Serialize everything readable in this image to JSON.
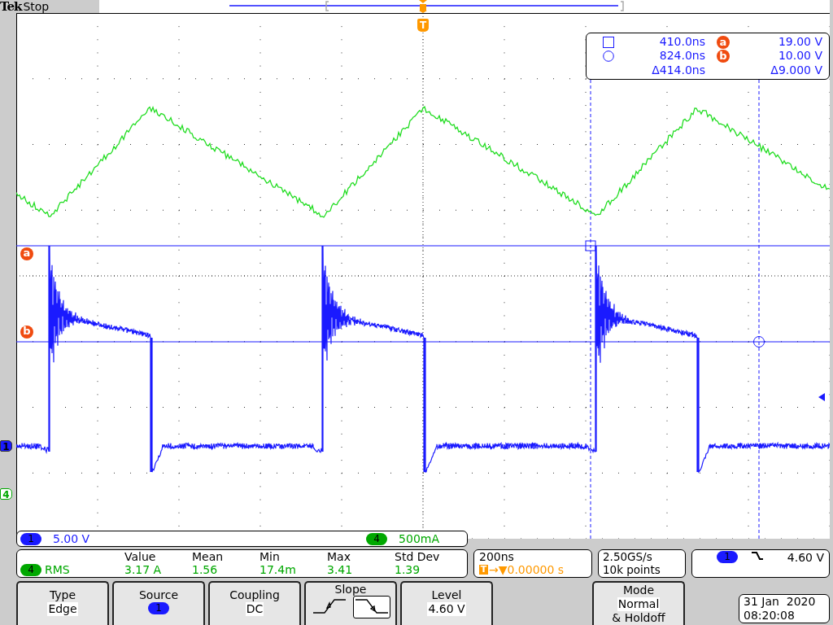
{
  "header": {
    "brand": "Tek",
    "state": "Stop"
  },
  "display": {
    "trigger_marker": "T",
    "cursor_labels": [
      {
        "label": "a"
      },
      {
        "label": "b"
      }
    ],
    "channel_markers": [
      {
        "label": "1",
        "color": "#1a1aff"
      },
      {
        "label": "4",
        "color": "#00a800"
      }
    ]
  },
  "cursor_readout": {
    "rows": [
      {
        "kind": "square",
        "time": "410.0ns",
        "label": "a",
        "value": "19.00 V"
      },
      {
        "kind": "circle",
        "time": "824.0ns",
        "label": "b",
        "value": "10.00 V"
      }
    ],
    "delta_time": "Δ414.0ns",
    "delta_value": "Δ9.000 V"
  },
  "channel_scales": [
    {
      "channel": "1",
      "scale": "5.00 V",
      "color": "#1a1aff"
    },
    {
      "channel": "4",
      "scale": "500mA",
      "color": "#00a800"
    }
  ],
  "measurement": {
    "channel": "4",
    "name": "RMS",
    "stats": [
      {
        "header": "Value",
        "value": "3.17 A"
      },
      {
        "header": "Mean",
        "value": "1.56"
      },
      {
        "header": "Min",
        "value": "17.4m"
      },
      {
        "header": "Max",
        "value": "3.41"
      },
      {
        "header": "Std Dev",
        "value": "1.39"
      }
    ]
  },
  "timebase": {
    "scale": "200ns",
    "trigger_icon": "T",
    "position": "→▼0.00000 s"
  },
  "acquisition": {
    "sample_rate": "2.50GS/s",
    "record_length": "10k points"
  },
  "trigger": {
    "channel": "1",
    "level": "4.60 V"
  },
  "menu": [
    {
      "kind": "value",
      "title": "Type",
      "value": "Edge"
    },
    {
      "kind": "channel",
      "title": "Source",
      "value": "1"
    },
    {
      "kind": "value",
      "title": "Coupling",
      "value": "DC"
    },
    {
      "kind": "slope",
      "title": "Slope",
      "options": [
        {
          "kind": "rising",
          "selected": false
        },
        {
          "kind": "falling",
          "selected": true
        }
      ]
    },
    {
      "kind": "value",
      "title": "Level",
      "value": "4.60 V"
    },
    {
      "kind": "mode",
      "title": "Mode",
      "value": "Normal",
      "note": "& Holdoff"
    }
  ],
  "date": "31 Jan  2020",
  "time": "08:20:08"
}
